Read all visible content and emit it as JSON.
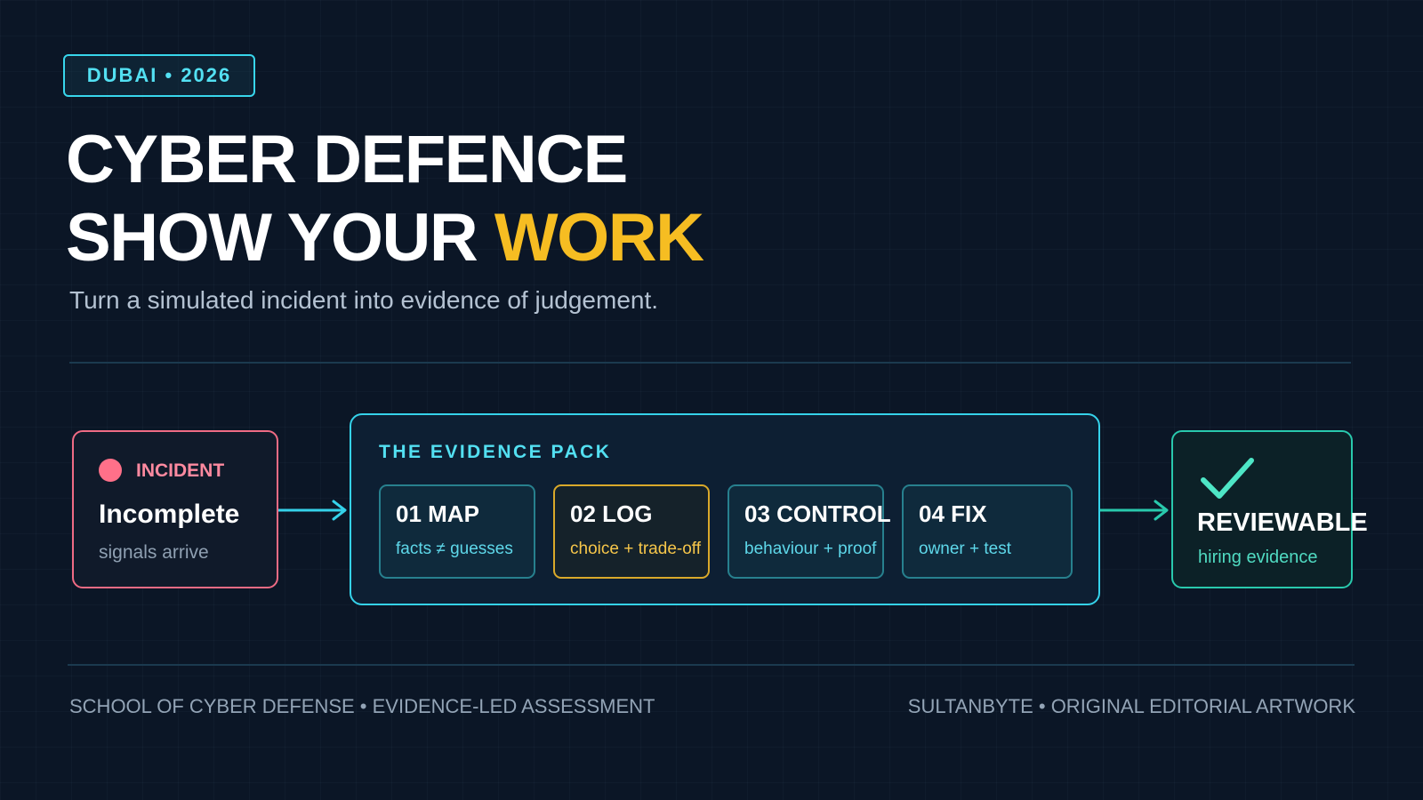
{
  "badge": "DUBAI • 2026",
  "title": {
    "line1": "CYBER DEFENCE",
    "line2_prefix": "SHOW YOUR ",
    "line2_accent": "WORK"
  },
  "subtitle": "Turn a simulated incident into evidence of judgement.",
  "incident": {
    "tag": "INCIDENT",
    "title": "Incomplete",
    "subtitle": "signals arrive"
  },
  "evidence_pack": {
    "title": "THE EVIDENCE PACK",
    "steps": [
      {
        "label": "01 MAP",
        "sub": "facts ≠ guesses"
      },
      {
        "label": "02 LOG",
        "sub": "choice + trade-off"
      },
      {
        "label": "03 CONTROL",
        "sub": "behaviour + proof"
      },
      {
        "label": "04 FIX",
        "sub": "owner + test"
      }
    ]
  },
  "reviewable": {
    "title": "REVIEWABLE",
    "subtitle": "hiring evidence"
  },
  "footer": {
    "left": "SCHOOL OF CYBER DEFENSE • EVIDENCE-LED ASSESSMENT",
    "right": "SULTANBYTE • ORIGINAL EDITORIAL ARTWORK"
  },
  "colors": {
    "background": "#0b1626",
    "accent_cyan": "#35d2ea",
    "accent_gold": "#f6bd22",
    "incident_pink": "#ef6b84",
    "success_teal": "#29c9ad"
  },
  "icons": {
    "incident": "alert-dot-icon",
    "reviewable": "checkmark-icon",
    "flow": "arrow-right-icon"
  }
}
